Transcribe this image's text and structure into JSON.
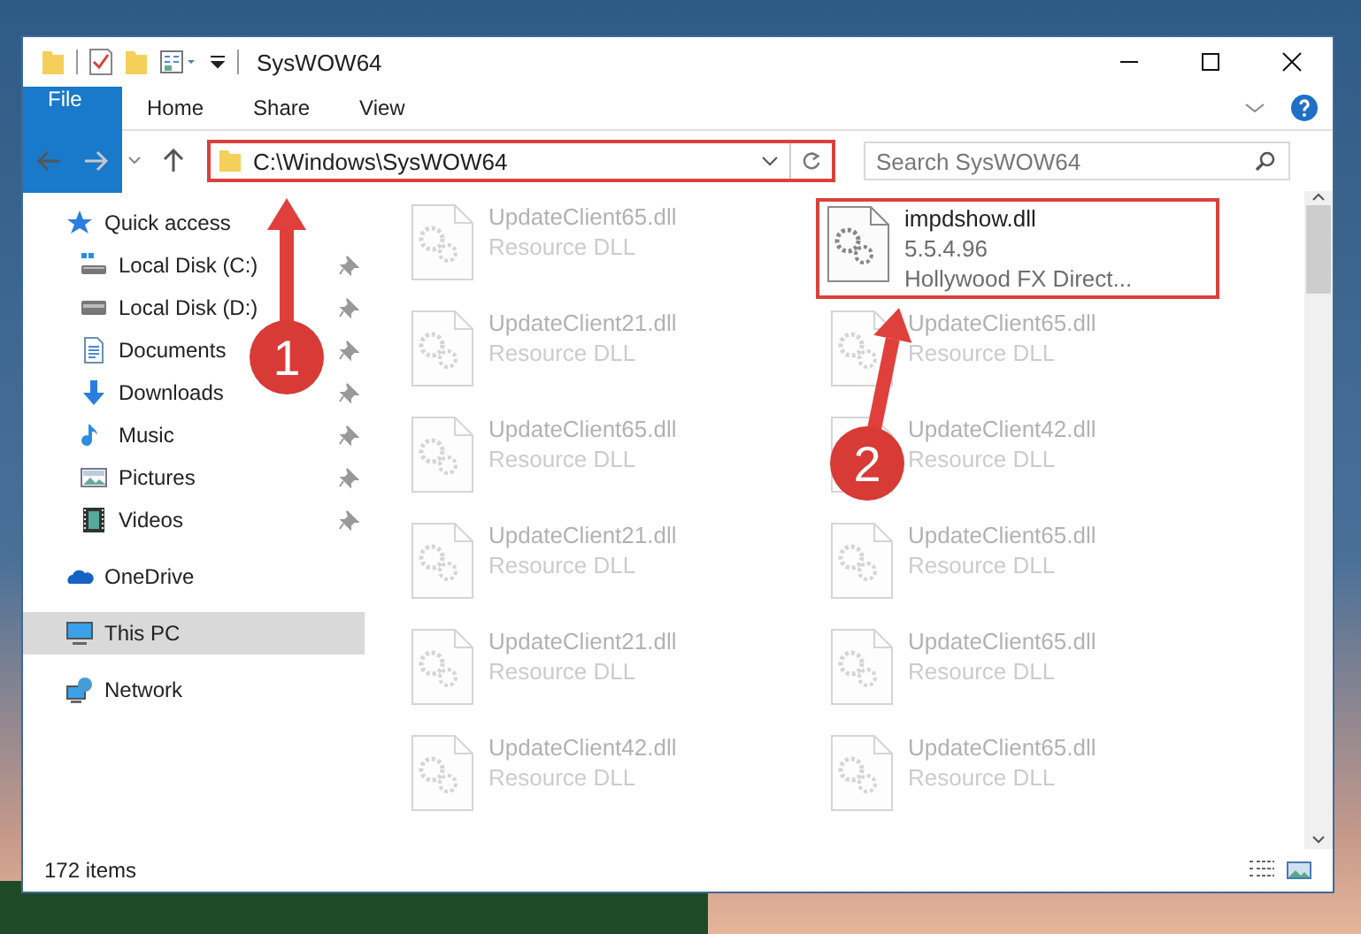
{
  "window": {
    "title": "SysWOW64"
  },
  "ribbon": {
    "tabs": [
      {
        "label": "File",
        "kind": "file"
      },
      {
        "label": "Home",
        "kind": "tab"
      },
      {
        "label": "Share",
        "kind": "tab"
      },
      {
        "label": "View",
        "kind": "tab"
      }
    ]
  },
  "address": {
    "path": "C:\\Windows\\SysWOW64",
    "highlighted": true
  },
  "search": {
    "placeholder": "Search SysWOW64"
  },
  "sidebar": {
    "items": [
      {
        "label": "Quick access",
        "kind": "star",
        "selected": false,
        "children": [
          {
            "label": "Local Disk (C:)",
            "kind": "system-drive",
            "pinned": true,
            "selected": false
          },
          {
            "label": "Local Disk (D:)",
            "kind": "drive",
            "pinned": true,
            "selected": false
          },
          {
            "label": "Documents",
            "kind": "documents",
            "pinned": true,
            "selected": false
          },
          {
            "label": "Downloads",
            "kind": "downloads",
            "pinned": true,
            "selected": false
          },
          {
            "label": "Music",
            "kind": "music",
            "pinned": true,
            "selected": false
          },
          {
            "label": "Pictures",
            "kind": "pictures",
            "pinned": true,
            "selected": false
          },
          {
            "label": "Videos",
            "kind": "videos",
            "pinned": true,
            "selected": false
          }
        ]
      },
      {
        "label": "OneDrive",
        "kind": "cloud",
        "selected": false
      },
      {
        "label": "This PC",
        "kind": "computer",
        "selected": true
      },
      {
        "label": "Network",
        "kind": "network",
        "selected": false
      }
    ]
  },
  "files": {
    "columns": [
      [
        {
          "name": "UpdateClient65.dll",
          "details": [
            "Resource DLL"
          ],
          "blurred": true,
          "highlighted": false
        },
        {
          "name": "UpdateClient21.dll",
          "details": [
            "Resource DLL"
          ],
          "blurred": true,
          "highlighted": false
        },
        {
          "name": "UpdateClient65.dll",
          "details": [
            "Resource DLL"
          ],
          "blurred": true,
          "highlighted": false
        },
        {
          "name": "UpdateClient21.dll",
          "details": [
            "Resource DLL"
          ],
          "blurred": true,
          "highlighted": false
        },
        {
          "name": "UpdateClient21.dll",
          "details": [
            "Resource DLL"
          ],
          "blurred": true,
          "highlighted": false
        },
        {
          "name": "UpdateClient42.dll",
          "details": [
            "Resource DLL"
          ],
          "blurred": true,
          "highlighted": false
        }
      ],
      [
        {
          "name": "impdshow.dll",
          "details": [
            "5.5.4.96",
            "Hollywood FX Direct..."
          ],
          "blurred": false,
          "highlighted": true
        },
        {
          "name": "UpdateClient65.dll",
          "details": [
            "Resource DLL"
          ],
          "blurred": true,
          "highlighted": false
        },
        {
          "name": "UpdateClient42.dll",
          "details": [
            "Resource DLL"
          ],
          "blurred": true,
          "highlighted": false
        },
        {
          "name": "UpdateClient65.dll",
          "details": [
            "Resource DLL"
          ],
          "blurred": true,
          "highlighted": false
        },
        {
          "name": "UpdateClient65.dll",
          "details": [
            "Resource DLL"
          ],
          "blurred": true,
          "highlighted": false
        },
        {
          "name": "UpdateClient65.dll",
          "details": [
            "Resource DLL"
          ],
          "blurred": true,
          "highlighted": false
        }
      ]
    ]
  },
  "status_bar": {
    "count": "172 items"
  },
  "callouts": [
    {
      "number": "1"
    },
    {
      "number": "2"
    }
  ]
}
